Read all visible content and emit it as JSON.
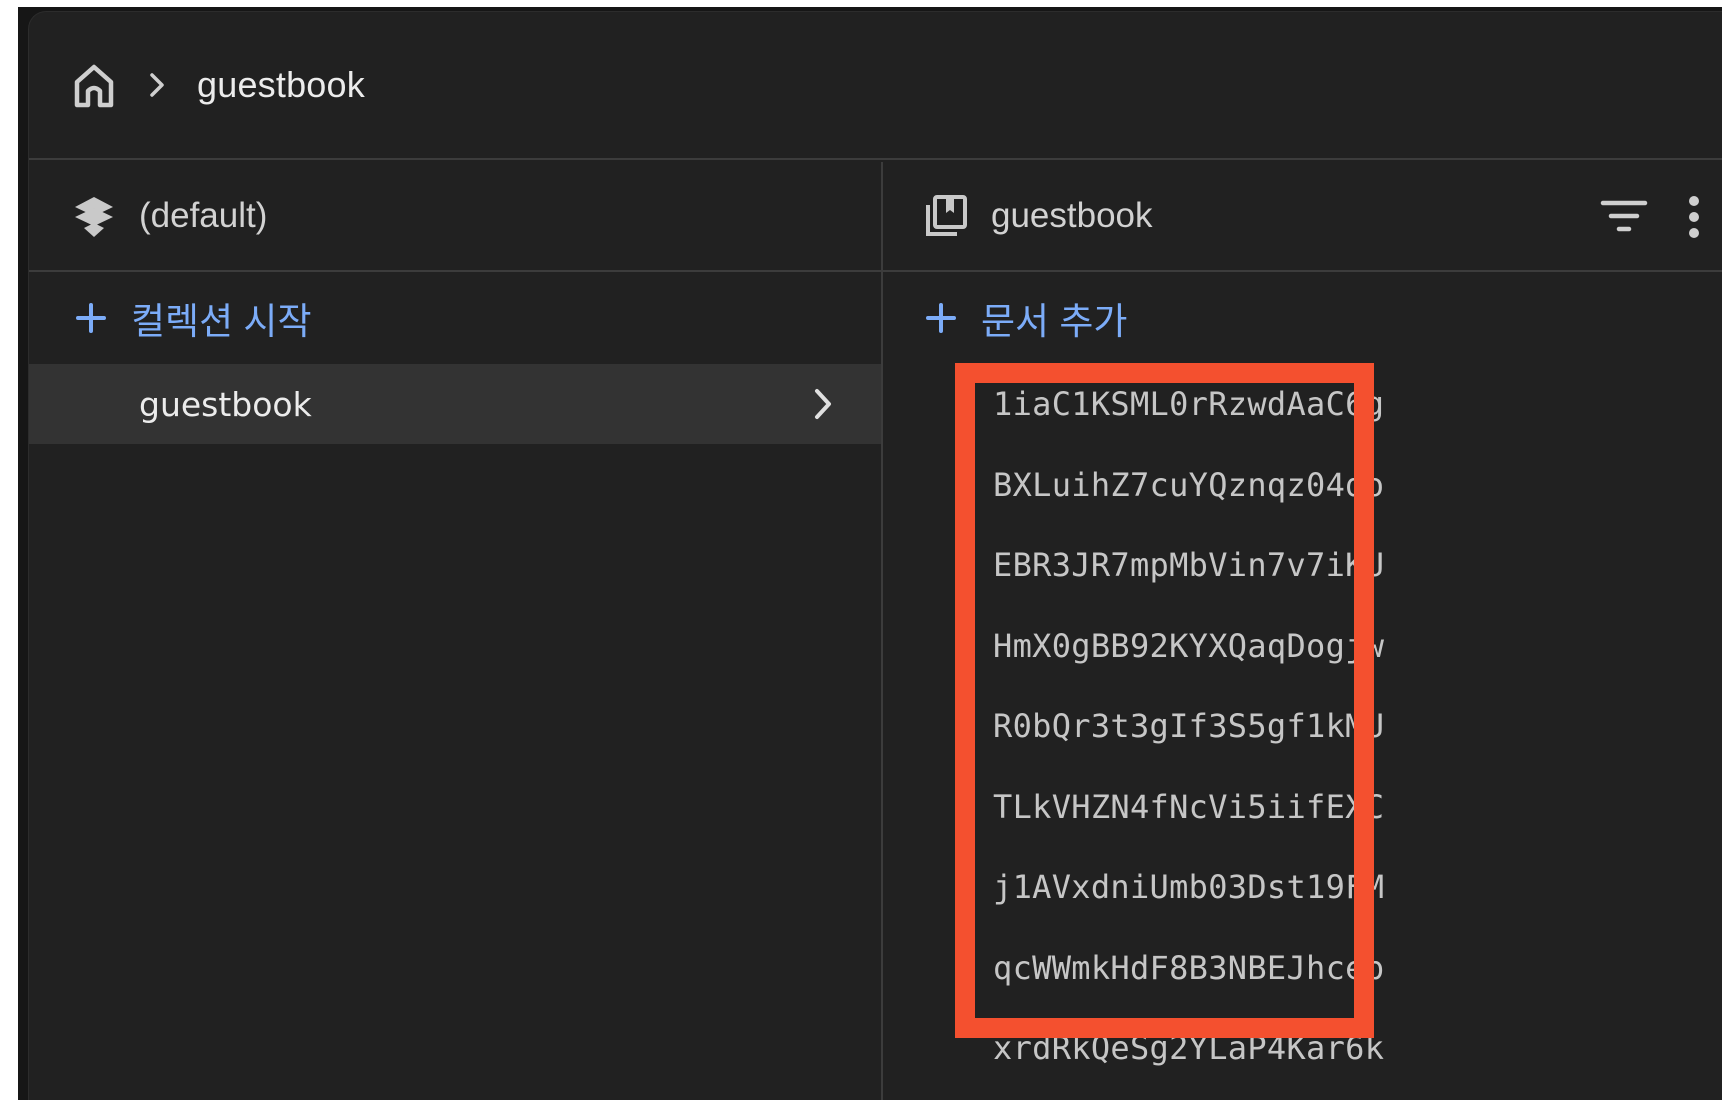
{
  "breadcrumb": {
    "home_icon": "home-icon",
    "separator_icon": "chevron-right-icon",
    "current": "guestbook"
  },
  "database_column": {
    "icon": "firestore-stack-icon",
    "title": "(default)",
    "add_label": "컬렉션 시작",
    "collections": [
      {
        "label": "guestbook",
        "selected": true
      }
    ]
  },
  "collection_column": {
    "icon": "collection-icon",
    "title": "guestbook",
    "filter_icon": "filter-icon",
    "more_icon": "more-vert-icon",
    "add_label": "문서 추가",
    "documents": [
      "1iaC1KSML0rRzwdAaC6g",
      "BXLuihZ7cuYQznqz04do",
      "EBR3JR7mpMbVin7v7iKU",
      "HmX0gBB92KYXQaqDogjw",
      "R0bQr3t3gIf3S5gf1kMU",
      "TLkVHZN4fNcVi5iifEXC",
      "j1AVxdniUmb03Dst19FM",
      "qcWWmkHdF8B3NBEJhceb",
      "xrdRkQeSg2YLaP4Kar6k"
    ]
  },
  "colors": {
    "background": "#212121",
    "accent": "#7cacf8",
    "highlight": "#f4502f",
    "selected_row": "#333333"
  }
}
